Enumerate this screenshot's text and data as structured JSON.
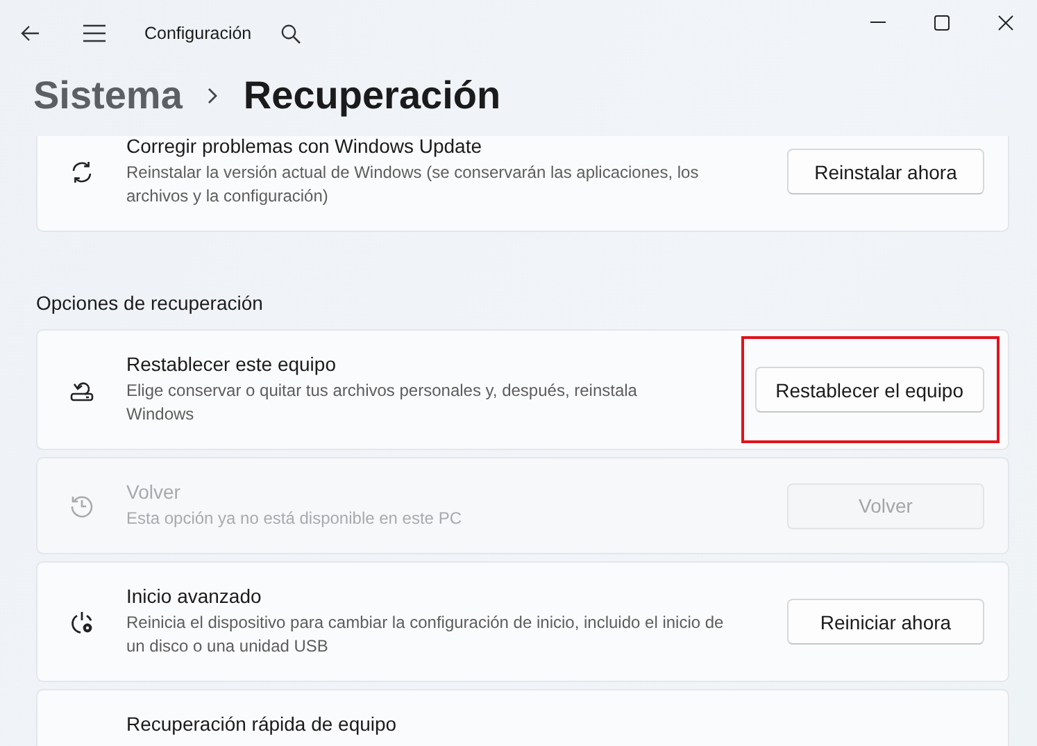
{
  "window": {
    "title": "Configuración"
  },
  "breadcrumb": {
    "parent": "Sistema",
    "current": "Recuperación"
  },
  "items": [
    {
      "kind": "card",
      "title": "Corregir problemas con Windows Update",
      "description": "Reinstalar la versión actual de Windows (se conservarán las aplicaciones, los archivos y la configuración)",
      "button": {
        "label": "Reinstalar ahora",
        "disabled": false
      },
      "disabled": false,
      "highlighted": false
    },
    {
      "kind": "heading",
      "text": "Opciones de recuperación"
    },
    {
      "kind": "card",
      "title": "Restablecer este equipo",
      "description": "Elige conservar o quitar tus archivos personales y, después, reinstala Windows",
      "button": {
        "label": "Restablecer el equipo",
        "disabled": false
      },
      "disabled": false,
      "highlighted": true
    },
    {
      "kind": "card",
      "title": "Volver",
      "description": "Esta opción ya no está disponible en este PC",
      "button": {
        "label": "Volver",
        "disabled": true
      },
      "disabled": true,
      "highlighted": false
    },
    {
      "kind": "card",
      "title": "Inicio avanzado",
      "description": "Reinicia el dispositivo para cambiar la configuración de inicio, incluido el inicio de un disco o una unidad USB",
      "button": {
        "label": "Reiniciar ahora",
        "disabled": false
      },
      "disabled": false,
      "highlighted": false
    },
    {
      "kind": "card",
      "title": "Recuperación rápida de equipo"
    }
  ]
}
